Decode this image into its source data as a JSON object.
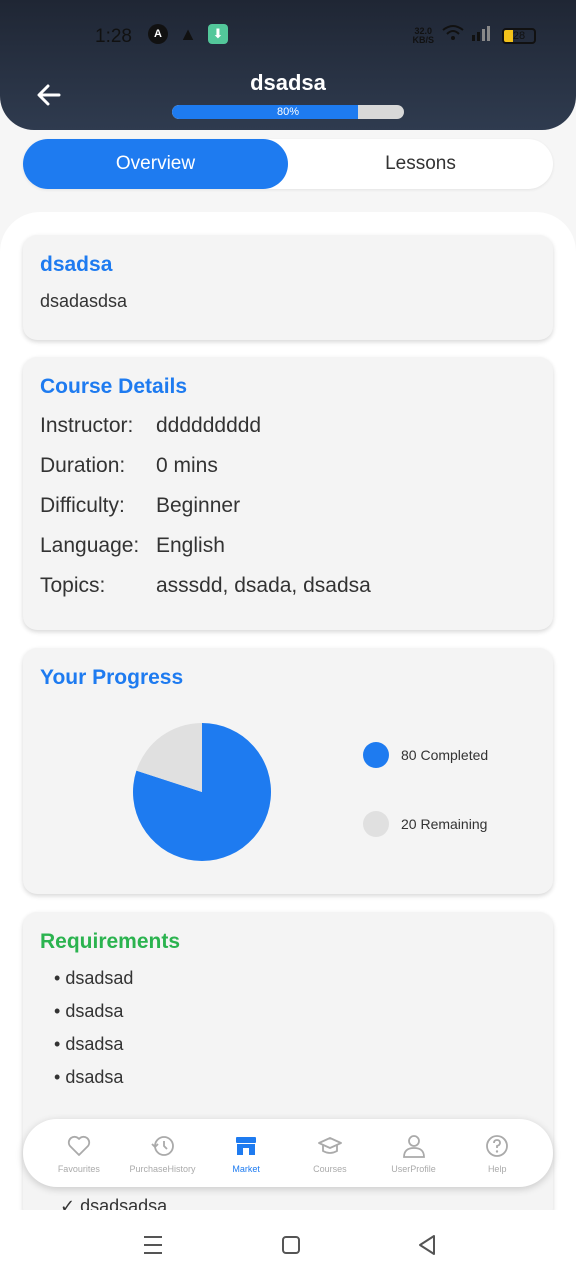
{
  "status_bar": {
    "time": "1:28",
    "net_speed_top": "32.0",
    "net_speed_bottom": "KB/S",
    "battery": "28"
  },
  "header": {
    "title": "dsadsa",
    "progress_label": "80%",
    "progress_value": 0.8
  },
  "tabs": [
    {
      "label": "Overview",
      "active": true
    },
    {
      "label": "Lessons",
      "active": false
    }
  ],
  "summary": {
    "title": "dsadsa",
    "description": "dsadasdsa"
  },
  "course_details": {
    "title": "Course Details",
    "rows": [
      {
        "label": "Instructor:",
        "value": "ddddddddd"
      },
      {
        "label": "Duration:",
        "value": "0 mins"
      },
      {
        "label": "Difficulty:",
        "value": "Beginner"
      },
      {
        "label": "Language:",
        "value": "English"
      },
      {
        "label": "Topics:",
        "value": "asssdd, dsada, dsadsa"
      }
    ]
  },
  "progress": {
    "title": "Your Progress",
    "completed_label": "80 Completed",
    "remaining_label": "20 Remaining",
    "colors": {
      "completed": "#1e7bf0",
      "remaining": "#e0e0e0"
    }
  },
  "chart_data": {
    "type": "pie",
    "categories": [
      "Completed",
      "Remaining"
    ],
    "values": [
      80,
      20
    ]
  },
  "requirements": {
    "title": "Requirements",
    "items": [
      "dsadsad",
      "dsadsa",
      "dsadsa",
      "dsadsa"
    ]
  },
  "peek": {
    "text": "✓ dsadsadsa"
  },
  "bottom_nav": [
    {
      "label": "Favourites",
      "icon": "heart-icon",
      "active": false
    },
    {
      "label": "PurchaseHistory",
      "icon": "history-icon",
      "active": false
    },
    {
      "label": "Market",
      "icon": "store-icon",
      "active": true
    },
    {
      "label": "Courses",
      "icon": "graduation-cap-icon",
      "active": false
    },
    {
      "label": "UserProfile",
      "icon": "user-icon",
      "active": false
    },
    {
      "label": "Help",
      "icon": "help-icon",
      "active": false
    }
  ]
}
